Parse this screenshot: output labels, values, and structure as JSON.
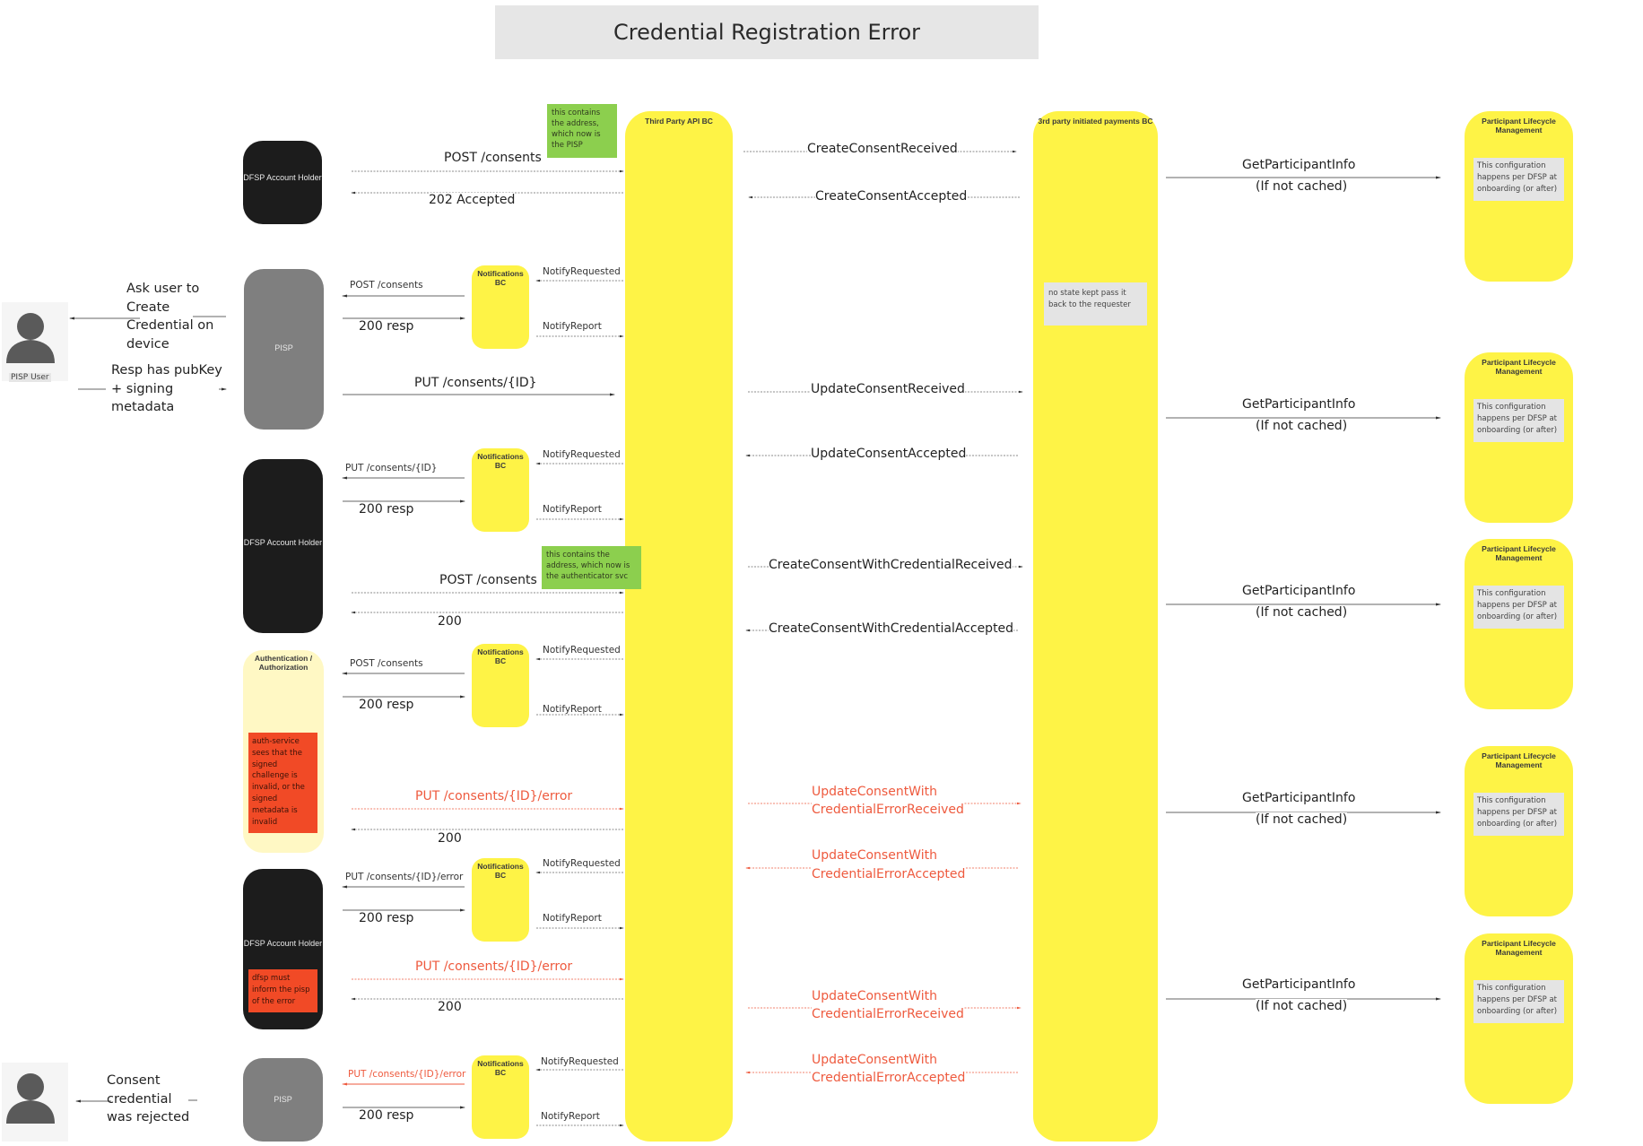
{
  "title": "Credential Registration Error",
  "colors": {
    "lane_yellow": "#fef346",
    "dark_box": "#1c1c1c",
    "grey_box": "#7f7f7f",
    "auth_box": "#fff8c4",
    "note_green": "#8ccf4e",
    "note_red": "#f14a26",
    "note_grey": "#e4e4e4",
    "error_text": "#ee5a3e"
  },
  "lanes": {
    "third_party_api": "Third Party API BC",
    "payments": "3rd party initiated payments BC",
    "plm": "Participant Lifecycle Management"
  },
  "plm_note": "This configuration happens per DFSP at onboarding (or after)",
  "payments_note": "no state kept pass it back to the requester",
  "actors": {
    "pisp_user": "PISP User",
    "dfsp": "DFSP Account Holder",
    "pisp": "PISP",
    "auth": "Authentication / Authorization",
    "notifications": "Notifications BC"
  },
  "notes": {
    "green1": "this contains the address, which now is the PISP",
    "green2": "this contains the address, which now is the authenticator svc",
    "red_auth": "auth-service sees that the signed challenge is invalid, or the signed metadata is invalid",
    "red_dfsp": "dfsp must inform the pisp of the error"
  },
  "user_messages": {
    "ask": "Ask user to Create Credential on device",
    "resp": "Resp has pubKey + signing metadata",
    "rejected": "Consent credential was rejected"
  },
  "messages": {
    "post_consents": "POST /consents",
    "accepted_202": "202 Accepted",
    "put_consents_id": "PUT /consents/{ID}",
    "put_consents_id_error": "PUT /consents/{ID}/error",
    "resp_200": "200 resp",
    "ok_200": "200",
    "notify_requested": "NotifyRequested",
    "notify_report": "NotifyReport",
    "create_consent_received": "CreateConsentReceived",
    "create_consent_accepted": "CreateConsentAccepted",
    "update_consent_received": "UpdateConsentReceived",
    "update_consent_accepted": "UpdateConsentAccepted",
    "ccwc_received": "CreateConsentWithCredentialReceived",
    "ccwc_accepted": "CreateConsentWithCredentialAccepted",
    "ucwce_received_1": "UpdateConsentWith",
    "ucwce_received_2": "CredentialErrorReceived",
    "ucwce_accepted_1": "UpdateConsentWith",
    "ucwce_accepted_2": "CredentialErrorAccepted",
    "get_participant_info": "GetParticipantInfo",
    "if_not_cached": "(If not cached)"
  }
}
